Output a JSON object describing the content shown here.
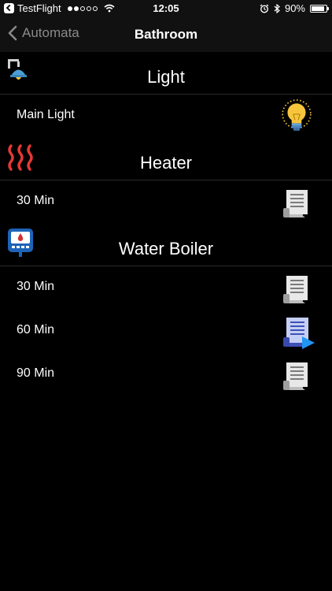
{
  "status_bar": {
    "back_app": "TestFlight",
    "time": "12:05",
    "battery": "90%",
    "battery_level": 0.9,
    "signal_bars_filled": 2,
    "signal_bars_total": 5
  },
  "nav": {
    "back_label": "Automata",
    "title": "Bathroom"
  },
  "sections": [
    {
      "title": "Light",
      "icon": "lamp-icon",
      "rows": [
        {
          "label": "Main Light",
          "icon": "lightbulb-icon"
        }
      ]
    },
    {
      "title": "Heater",
      "icon": "heat-waves-icon",
      "rows": [
        {
          "label": "30 Min",
          "icon": "script-icon"
        }
      ]
    },
    {
      "title": "Water Boiler",
      "icon": "water-boiler-icon",
      "rows": [
        {
          "label": "30 Min",
          "icon": "script-icon"
        },
        {
          "label": "60 Min",
          "icon": "script-run-icon"
        },
        {
          "label": "90 Min",
          "icon": "script-icon"
        }
      ]
    }
  ],
  "colors": {
    "background": "#000000",
    "bar_background": "#111111",
    "back_text": "#8a8a8a",
    "heat_red": "#e53935",
    "bulb_yellow": "#f7c53b",
    "boiler_blue": "#1e63b8",
    "run_blue": "#2196f3"
  }
}
